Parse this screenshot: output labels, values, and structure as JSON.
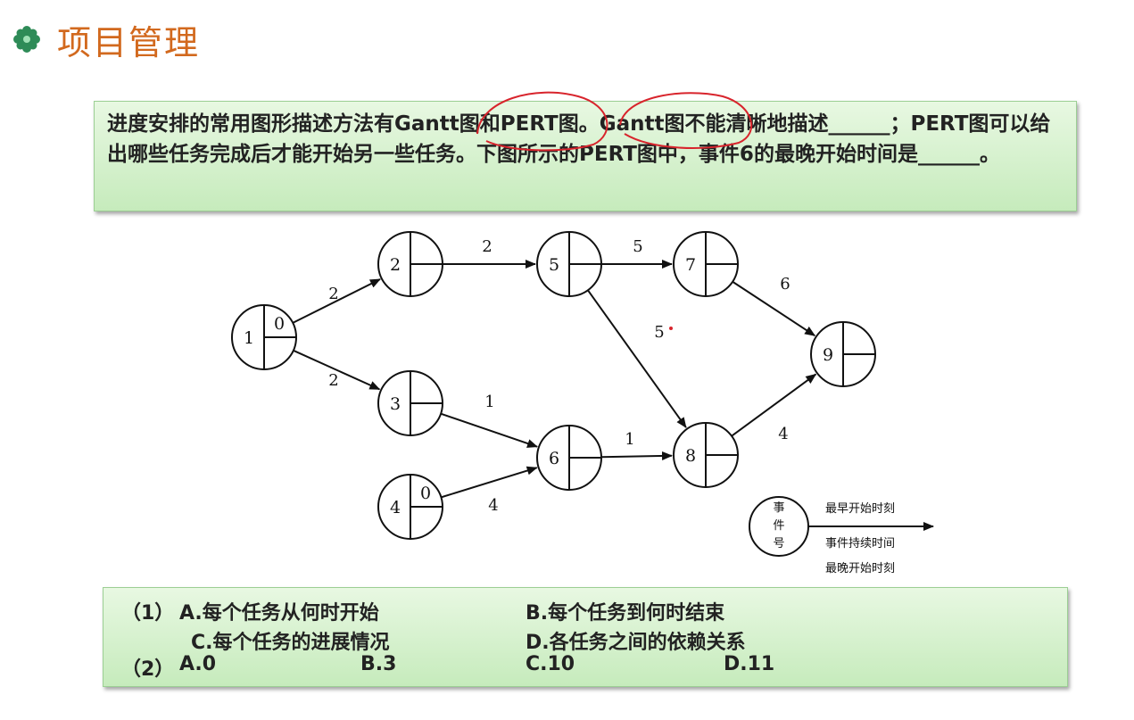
{
  "header": {
    "title": "项目管理",
    "bullet_icon": "flower-bullet-icon",
    "accent_color": "#d2691e"
  },
  "question": {
    "text": "进度安排的常用图形描述方法有Gantt图和PERT图。Gantt图不能清晰地描述______；PERT图可以给出哪些任务完成后才能开始另一些任务。下图所示的PERT图中，事件6的最晚开始时间是______。",
    "background_color": "#d3f0cb"
  },
  "diagram": {
    "nodes": [
      {
        "id": "1",
        "early": "0"
      },
      {
        "id": "2",
        "early": ""
      },
      {
        "id": "3",
        "early": ""
      },
      {
        "id": "4",
        "early": "0"
      },
      {
        "id": "5",
        "early": ""
      },
      {
        "id": "6",
        "early": ""
      },
      {
        "id": "7",
        "early": ""
      },
      {
        "id": "8",
        "early": ""
      },
      {
        "id": "9",
        "early": ""
      }
    ],
    "edges": [
      {
        "from": "1",
        "to": "2",
        "label": "2"
      },
      {
        "from": "1",
        "to": "3",
        "label": "2"
      },
      {
        "from": "2",
        "to": "5",
        "label": "2"
      },
      {
        "from": "3",
        "to": "6",
        "label": "1"
      },
      {
        "from": "4",
        "to": "6",
        "label": "4"
      },
      {
        "from": "5",
        "to": "7",
        "label": "5"
      },
      {
        "from": "5",
        "to": "8",
        "label": "5"
      },
      {
        "from": "6",
        "to": "8",
        "label": "1"
      },
      {
        "from": "7",
        "to": "9",
        "label": "6"
      },
      {
        "from": "8",
        "to": "9",
        "label": "4"
      }
    ],
    "legend": {
      "event_chars": [
        "事",
        "件",
        "号"
      ],
      "earliest": "最早开始时刻",
      "duration": "事件持续时间",
      "latest": "最晚开始时刻"
    }
  },
  "options": {
    "q1_prefix": "（1）",
    "q1_a": "A.每个任务从何时开始",
    "q1_b": "B.每个任务到何时结束",
    "q1_c": "C.每个任务的进展情况",
    "q1_d": "D.各任务之间的依赖关系",
    "q2_prefix": "（2）",
    "q2_a": "A.0",
    "q2_b": "B.3",
    "q2_c": "C.10",
    "q2_d": "D.11"
  }
}
